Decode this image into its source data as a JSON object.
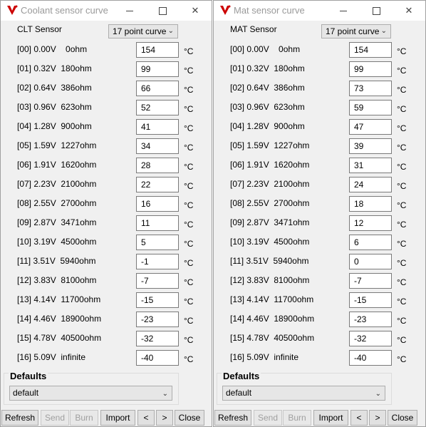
{
  "windows": [
    {
      "title": "Coolant sensor curve",
      "sensor_label": "CLT Sensor",
      "curve_select": "17 point curve",
      "unit": "°C",
      "rows": [
        {
          "label": "[00] 0.00V    0ohm",
          "value": "154"
        },
        {
          "label": "[01] 0.32V  180ohm",
          "value": "99"
        },
        {
          "label": "[02] 0.64V  386ohm",
          "value": "66"
        },
        {
          "label": "[03] 0.96V  623ohm",
          "value": "52"
        },
        {
          "label": "[04] 1.28V  900ohm",
          "value": "41"
        },
        {
          "label": "[05] 1.59V  1227ohm",
          "value": "34"
        },
        {
          "label": "[06] 1.91V  1620ohm",
          "value": "28"
        },
        {
          "label": "[07] 2.23V  2100ohm",
          "value": "22"
        },
        {
          "label": "[08] 2.55V  2700ohm",
          "value": "16"
        },
        {
          "label": "[09] 2.87V  3471ohm",
          "value": "11"
        },
        {
          "label": "[10] 3.19V  4500ohm",
          "value": "5"
        },
        {
          "label": "[11] 3.51V  5940ohm",
          "value": "-1"
        },
        {
          "label": "[12] 3.83V  8100ohm",
          "value": "-7"
        },
        {
          "label": "[13] 4.14V  11700ohm",
          "value": "-15"
        },
        {
          "label": "[14] 4.46V  18900ohm",
          "value": "-23"
        },
        {
          "label": "[15] 4.78V  40500ohm",
          "value": "-32"
        },
        {
          "label": "[16] 5.09V  infinite",
          "value": "-40"
        }
      ],
      "defaults_title": "Defaults",
      "defaults_select": "default",
      "buttons": [
        "Refresh",
        "Send",
        "Burn",
        "Import",
        "<",
        ">",
        "Close"
      ]
    },
    {
      "title": "Mat sensor curve",
      "sensor_label": "MAT Sensor",
      "curve_select": "17 point curve",
      "unit": "°C",
      "rows": [
        {
          "label": "[00] 0.00V    0ohm",
          "value": "154"
        },
        {
          "label": "[01] 0.32V  180ohm",
          "value": "99"
        },
        {
          "label": "[02] 0.64V  386ohm",
          "value": "73"
        },
        {
          "label": "[03] 0.96V  623ohm",
          "value": "59"
        },
        {
          "label": "[04] 1.28V  900ohm",
          "value": "47"
        },
        {
          "label": "[05] 1.59V  1227ohm",
          "value": "39"
        },
        {
          "label": "[06] 1.91V  1620ohm",
          "value": "31"
        },
        {
          "label": "[07] 2.23V  2100ohm",
          "value": "24"
        },
        {
          "label": "[08] 2.55V  2700ohm",
          "value": "18"
        },
        {
          "label": "[09] 2.87V  3471ohm",
          "value": "12"
        },
        {
          "label": "[10] 3.19V  4500ohm",
          "value": "6"
        },
        {
          "label": "[11] 3.51V  5940ohm",
          "value": "0"
        },
        {
          "label": "[12] 3.83V  8100ohm",
          "value": "-7"
        },
        {
          "label": "[13] 4.14V  11700ohm",
          "value": "-15"
        },
        {
          "label": "[14] 4.46V  18900ohm",
          "value": "-23"
        },
        {
          "label": "[15] 4.78V  40500ohm",
          "value": "-32"
        },
        {
          "label": "[16] 5.09V  infinite",
          "value": "-40"
        }
      ],
      "defaults_title": "Defaults",
      "defaults_select": "default",
      "buttons": [
        "Refresh",
        "Send",
        "Burn",
        "Import",
        "<",
        ">",
        "Close"
      ]
    }
  ],
  "icons": {
    "app": "app-logo-icon",
    "minimize": "minimize-icon",
    "maximize": "maximize-icon",
    "close": "close-icon",
    "dropdown": "chevron-down-icon"
  },
  "colors": {
    "logo": "#cc0000",
    "title_text": "#9a9a9a",
    "disabled_text": "#a0a0a0"
  }
}
